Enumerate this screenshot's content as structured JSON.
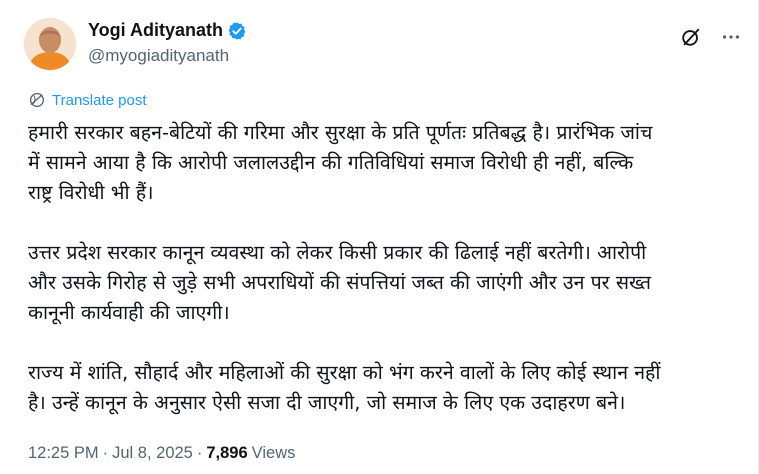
{
  "author": {
    "display_name": "Yogi Adityanath",
    "handle": "@myogiadityanath",
    "verified_icon": "verified-badge",
    "verified_color": "#1d9bf0"
  },
  "actions": {
    "grok_icon": "grok-icon",
    "more_icon": "more-icon"
  },
  "translate": {
    "label": "Translate post",
    "icon": "translate-globe-icon",
    "color": "#1d9bf0"
  },
  "post": {
    "paragraphs": [
      "हमारी सरकार बहन-बेटियों की गरिमा और सुरक्षा के प्रति पूर्णतः प्रतिबद्ध है। प्रारंभिक जांच\nमें सामने आया है कि आरोपी जलालउद्दीन की गतिविधियां समाज विरोधी ही नहीं, बल्कि\nराष्ट्र विरोधी भी हैं।",
      "उत्तर प्रदेश सरकार कानून व्यवस्था को लेकर किसी प्रकार की ढिलाई नहीं बरतेगी। आरोपी\nऔर उसके गिरोह से जुड़े सभी अपराधियों की संपत्तियां जब्त की जाएंगी और उन पर सख्त\nकानूनी कार्यवाही की जाएगी।",
      "राज्य में शांति, सौहार्द और महिलाओं की सुरक्षा को भंग करने वालों के लिए कोई स्थान नहीं\nहै। उन्हें कानून के अनुसार ऐसी सजा दी जाएगी, जो समाज के लिए एक उदाहरण बने।"
    ]
  },
  "meta": {
    "time": "12:25 PM",
    "separator": "·",
    "date": "Jul 8, 2025",
    "views_count": "7,896",
    "views_label": "Views"
  }
}
